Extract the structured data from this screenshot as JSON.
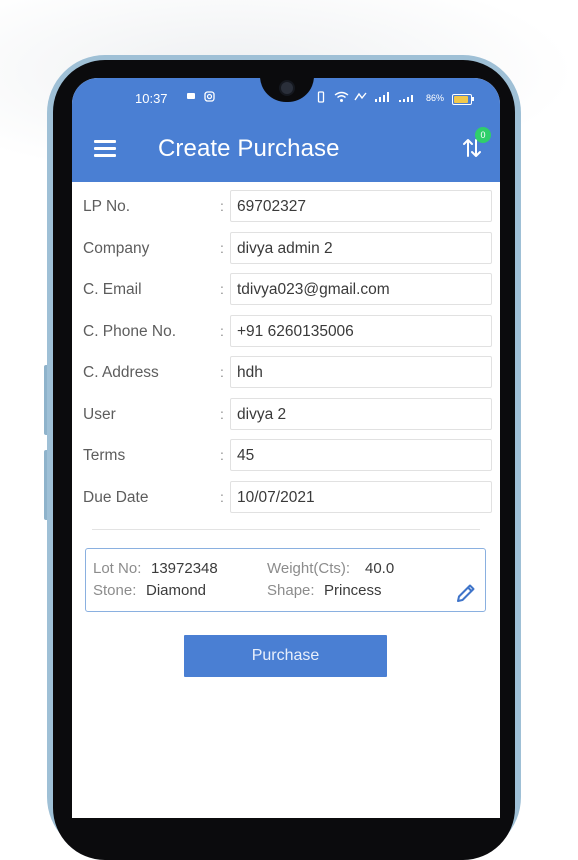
{
  "status_bar": {
    "time": "10:37",
    "battery_percent": "86%",
    "battery_level": 0.86
  },
  "header": {
    "title": "Create Purchase",
    "sort_badge_count": "0"
  },
  "form": {
    "fields": [
      {
        "label": "LP No.",
        "value": "69702327"
      },
      {
        "label": "Company",
        "value": "divya admin 2"
      },
      {
        "label": "C. Email",
        "value": "tdivya023@gmail.com"
      },
      {
        "label": "C. Phone No.",
        "value": "+91 6260135006"
      },
      {
        "label": "C. Address",
        "value": "hdh"
      },
      {
        "label": "User",
        "value": "divya 2"
      },
      {
        "label": "Terms",
        "value": "45"
      },
      {
        "label": "Due Date",
        "value": "10/07/2021"
      }
    ],
    "separator": ":"
  },
  "item_card": {
    "lot_no_label": "Lot No:",
    "lot_no": "13972348",
    "weight_label": "Weight(Cts):",
    "weight": "40.0",
    "stone_label": "Stone:",
    "stone": "Diamond",
    "shape_label": "Shape:",
    "shape": "Princess"
  },
  "actions": {
    "purchase_label": "Purchase"
  },
  "colors": {
    "primary": "#4a7fd3",
    "badge": "#2fcf6a",
    "card_border": "#8ab0e0",
    "device_frame": "#9fc0d6"
  },
  "icons": [
    "menu-icon",
    "sort-icon",
    "edit-pencil-icon",
    "wifi-icon",
    "signal-icon",
    "battery-icon",
    "camera-icon"
  ]
}
